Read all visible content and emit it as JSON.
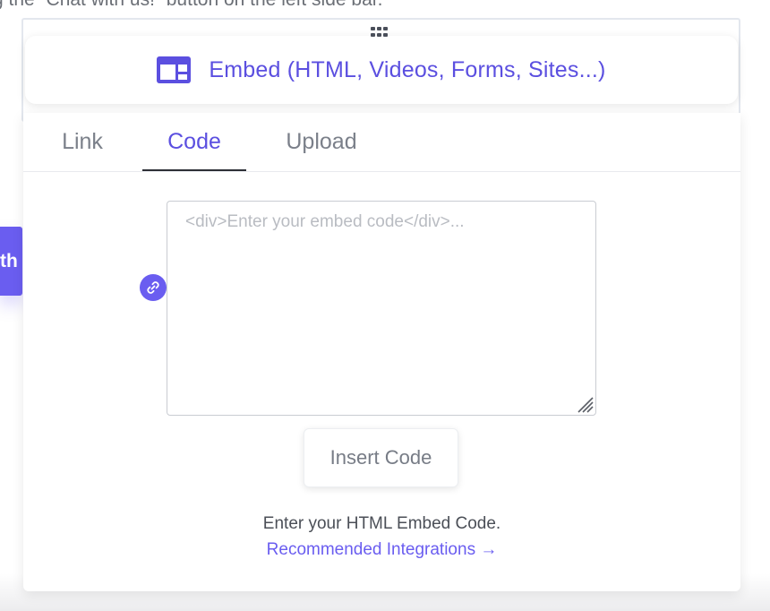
{
  "background": {
    "partial_text": "g the “Chat with us!” button on the left side bar.",
    "left_tab_label": "th"
  },
  "embed_block": {
    "icon": "embed-layout-icon",
    "title": "Embed (HTML, Videos, Forms, Sites...)",
    "accent_color": "#5b4fe0"
  },
  "tabs": [
    {
      "label": "Link",
      "active": false
    },
    {
      "label": "Code",
      "active": true
    },
    {
      "label": "Upload",
      "active": false
    }
  ],
  "code_input": {
    "placeholder": "<div>Enter your embed code</div>...",
    "value": ""
  },
  "link_badge_icon": "link-icon",
  "insert_button": {
    "label": "Insert Code"
  },
  "help_text": "Enter your HTML Embed Code.",
  "recommended_link": "Recommended Integrations →"
}
